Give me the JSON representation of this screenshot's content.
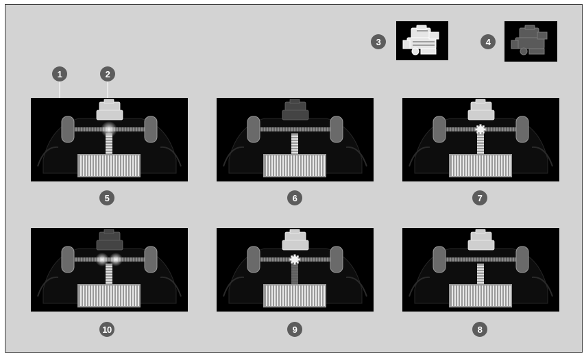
{
  "callouts": {
    "c1": "1",
    "c2": "2",
    "c3": "3",
    "c4": "4"
  },
  "panels": [
    {
      "label": "5",
      "state": "engine-to-wheels-and-battery",
      "engine_on": true,
      "gear": false,
      "axle_glow": "center",
      "shaft_glow": true
    },
    {
      "label": "6",
      "state": "battery-to-wheels",
      "engine_on": false,
      "gear": false,
      "axle_glow": "none",
      "shaft_glow": true
    },
    {
      "label": "7",
      "state": "engine-gear-drive",
      "engine_on": true,
      "gear": true,
      "axle_glow": "none",
      "shaft_glow": true
    },
    {
      "label": "10",
      "state": "regeneration",
      "engine_on": false,
      "gear": false,
      "axle_glow": "both",
      "shaft_glow": true
    },
    {
      "label": "9",
      "state": "engine-direct-drive",
      "engine_on": true,
      "gear": true,
      "axle_glow": "none",
      "shaft_glow": false
    },
    {
      "label": "8",
      "state": "engine-charging",
      "engine_on": true,
      "gear": false,
      "axle_glow": "none",
      "shaft_glow": true
    }
  ],
  "colors": {
    "background": "#d3d3d3",
    "badge": "#5c5c5c",
    "panel": "#000000"
  }
}
